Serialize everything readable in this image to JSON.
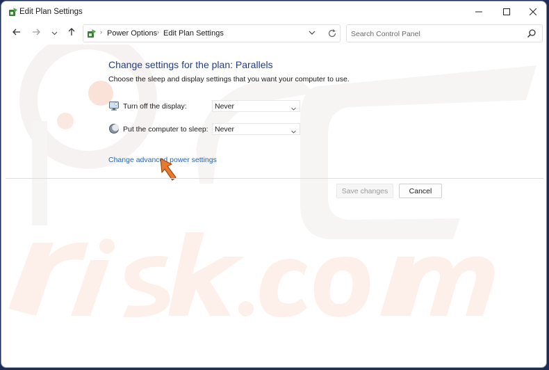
{
  "window": {
    "title": "Edit Plan Settings",
    "icon": "power-options-icon"
  },
  "navigation": {
    "back_icon": "arrow-left-icon",
    "forward_icon": "arrow-right-icon",
    "recent_icon": "chevron-down-icon",
    "up_icon": "arrow-up-icon",
    "breadcrumbs": [
      "Power Options",
      "Edit Plan Settings"
    ],
    "refresh_icon": "refresh-icon",
    "search_placeholder": "Search Control Panel"
  },
  "main": {
    "heading": "Change settings for the plan: Parallels",
    "subtext": "Choose the sleep and display settings that you want your computer to use.",
    "settings": [
      {
        "label": "Turn off the display:",
        "value": "Never",
        "icon": "monitor-icon"
      },
      {
        "label": "Put the computer to sleep:",
        "value": "Never",
        "icon": "moon-icon"
      }
    ],
    "advanced_link": "Change advanced power settings",
    "save_label": "Save changes",
    "cancel_label": "Cancel"
  },
  "colors": {
    "heading": "#1e3d8b",
    "link": "#2864b4",
    "pointer": "#e8792e",
    "disabled_text": "#9a9a9a"
  }
}
